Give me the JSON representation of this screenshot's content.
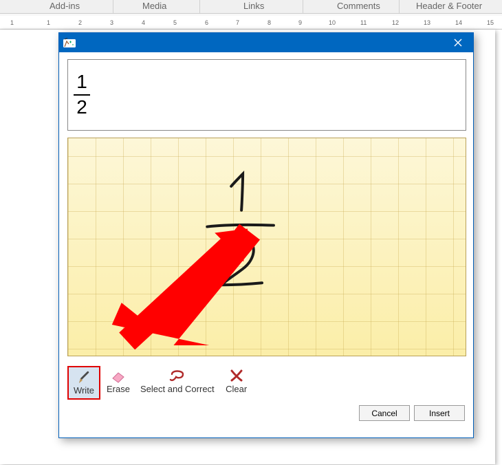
{
  "ribbon": {
    "tabs": {
      "addins": "Add-ins",
      "media": "Media",
      "links": "Links",
      "comments": "Comments",
      "header_footer": "Header & Footer"
    }
  },
  "ruler": {
    "marks": [
      "1",
      "1",
      "2",
      "3",
      "4",
      "5",
      "6",
      "7",
      "8",
      "9",
      "10",
      "11",
      "12",
      "13",
      "14",
      "15"
    ]
  },
  "dialog": {
    "preview": {
      "numerator": "1",
      "denominator": "2"
    },
    "tools": {
      "write": "Write",
      "erase": "Erase",
      "select_correct": "Select and Correct",
      "clear": "Clear"
    },
    "buttons": {
      "cancel": "Cancel",
      "insert": "Insert"
    }
  }
}
